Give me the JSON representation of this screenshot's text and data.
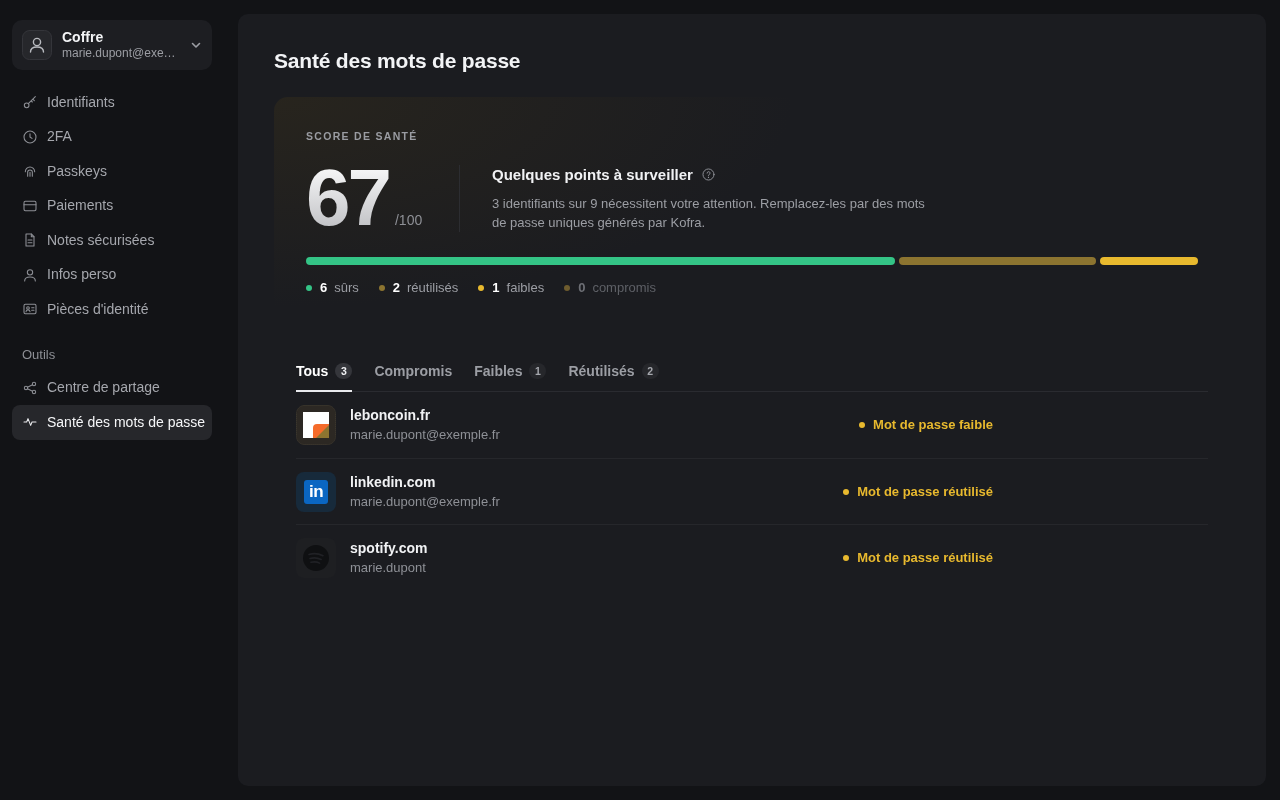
{
  "sidebar": {
    "vault": {
      "name": "Coffre",
      "account": "marie.dupont@exe…"
    },
    "sections": [
      {
        "items": [
          {
            "label": "Identifiants",
            "selected": false
          },
          {
            "label": "2FA",
            "selected": false
          },
          {
            "label": "Passkeys",
            "selected": false
          },
          {
            "label": "Paiements",
            "selected": false
          },
          {
            "label": "Notes sécurisées",
            "selected": false
          },
          {
            "label": "Infos perso",
            "selected": false
          },
          {
            "label": "Pièces d'identité",
            "selected": false
          }
        ]
      },
      {
        "title": "Outils",
        "items": [
          {
            "label": "Centre de partage",
            "selected": false
          },
          {
            "label": "Santé des mots de passe",
            "selected": true
          }
        ]
      }
    ]
  },
  "page": {
    "title": "Santé des mots de passe"
  },
  "score": {
    "label": "SCORE DE SANTÉ",
    "value": "67",
    "max": "/100",
    "heading": "Quelques points à surveiller",
    "description": "3 identifiants sur 9 nécessitent votre attention. Remplacez-les par des mots de passe uniques générés par Kofra.",
    "breakdown": [
      {
        "count": "6",
        "label": "sûrs",
        "color": "#34c486"
      },
      {
        "count": "2",
        "label": "réutilisés",
        "color": "#8c7430"
      },
      {
        "count": "1",
        "label": "faibles",
        "color": "#e8b92e"
      },
      {
        "count": "0",
        "label": "compromis",
        "color": "#6e5c2e"
      }
    ]
  },
  "tabs": [
    {
      "label": "Tous",
      "count": "3",
      "selected": true
    },
    {
      "label": "Compromis",
      "selected": false
    },
    {
      "label": "Faibles",
      "count": "1",
      "selected": false
    },
    {
      "label": "Réutilisés",
      "count": "2",
      "selected": false
    }
  ],
  "entries": [
    {
      "site": "leboncoin.fr",
      "account": "marie.dupont@exemple.fr",
      "status": "Mot de passe faible",
      "kind": "corner"
    },
    {
      "site": "linkedin.com",
      "account": "marie.dupont@exemple.fr",
      "status": "Mot de passe réutilisé",
      "kind": "letters",
      "logo_text": "in"
    },
    {
      "site": "spotify.com",
      "account": "marie.dupont",
      "status": "Mot de passe réutilisé",
      "kind": "disc"
    }
  ]
}
